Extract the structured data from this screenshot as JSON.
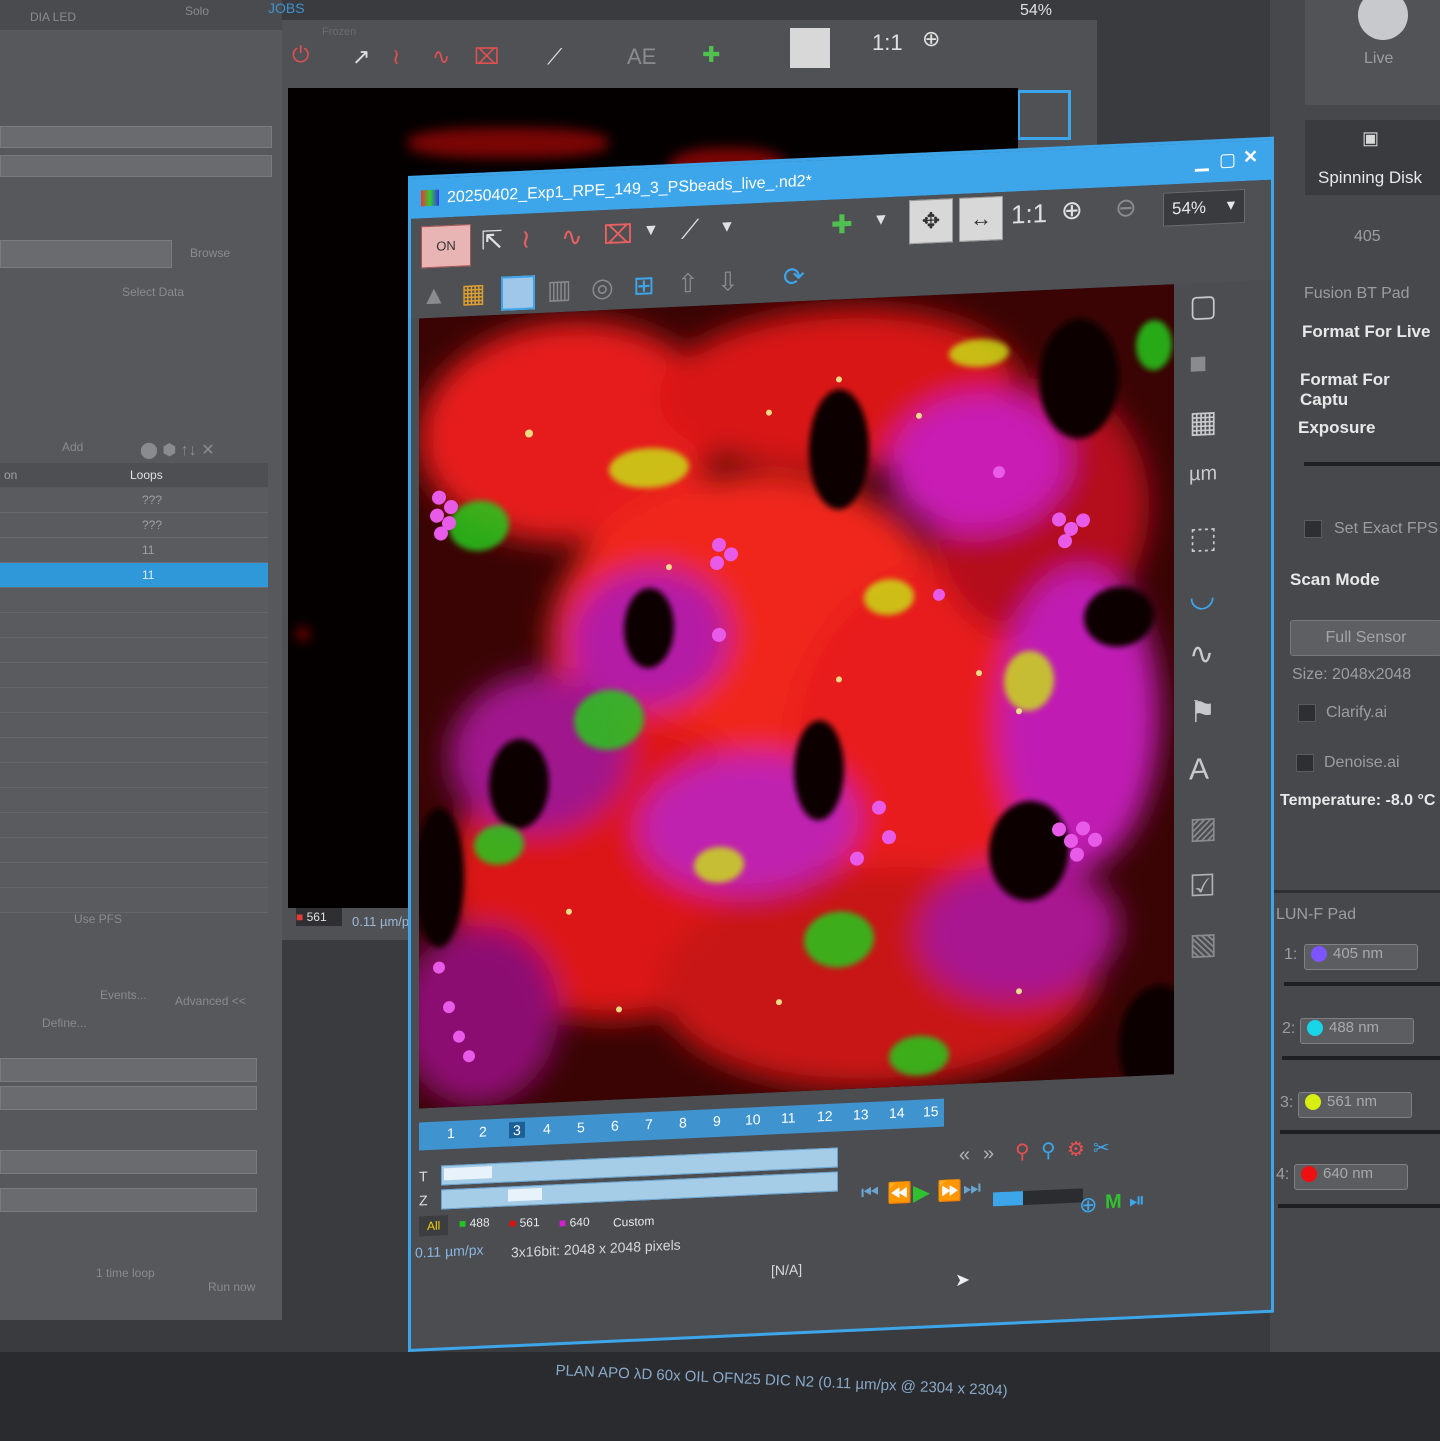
{
  "left_panel": {
    "top_tabs": [
      "DIA LED",
      "Solo",
      "JOBS"
    ],
    "browse_label": "Browse",
    "select_data_label": "Select Data",
    "toolbar_add": "Add",
    "col_loops": "Loops",
    "rows": [
      "???",
      "???",
      "11",
      "11"
    ],
    "events_btn": "Events...",
    "advanced_btn": "Advanced <<",
    "define_btn": "Define...",
    "use_pfs": "Use PFS",
    "time_loop": "1 time loop",
    "run_now": "Run now"
  },
  "bg_viewer": {
    "zoom": "54%",
    "channel": "561",
    "scale": "0.11 µm/p",
    "title_frag": "Frozen"
  },
  "window": {
    "title": "20250402_Exp1_RPE_149_3_PSbeads_live_.nd2*",
    "zoom": "54%",
    "one_to_one": "1:1",
    "frames": [
      "1",
      "2",
      "3",
      "4",
      "5",
      "6",
      "7",
      "8",
      "9",
      "10",
      "11",
      "12",
      "13",
      "14",
      "15"
    ],
    "t_label": "T",
    "z_label": "Z",
    "channels": [
      {
        "label": "All",
        "color": "#f2d000"
      },
      {
        "label": "488",
        "color": "#22c322"
      },
      {
        "label": "561",
        "color": "#e01010"
      },
      {
        "label": "640",
        "color": "#d020d0"
      },
      {
        "label": "Custom",
        "color": ""
      }
    ],
    "scale": "0.11 µm/px",
    "pixels": "3x16bit: 2048 x 2048 pixels",
    "na": "[N/A]"
  },
  "right_panel": {
    "live": "Live",
    "spinning_disk": "Spinning Disk",
    "wavelength": "405",
    "fusion": "Fusion BT Pad",
    "format_live": "Format For Live",
    "format_capture": "Format For Captu",
    "exposure": "Exposure",
    "set_exact_fps": "Set Exact FPS",
    "scan_mode": "Scan Mode",
    "full_sensor": "Full Sensor",
    "size": "Size: 2048x2048",
    "clarify": "Clarify.ai",
    "denoise": "Denoise.ai",
    "temperature": "Temperature: -8.0 °C",
    "lun": "LUN-F Pad",
    "lasers": [
      {
        "index": "1:",
        "label": "405 nm",
        "color": "#7b55ff"
      },
      {
        "index": "2:",
        "label": "488 nm",
        "color": "#18d6e8"
      },
      {
        "index": "3:",
        "label": "561 nm",
        "color": "#d6ee10"
      },
      {
        "index": "4:",
        "label": "640 nm",
        "color": "#ee1010"
      }
    ]
  },
  "bottom_objective": "PLAN APO λD 60x OIL OFN25 DIC N2 (0.11 µm/px @ 2304 x 2304)"
}
